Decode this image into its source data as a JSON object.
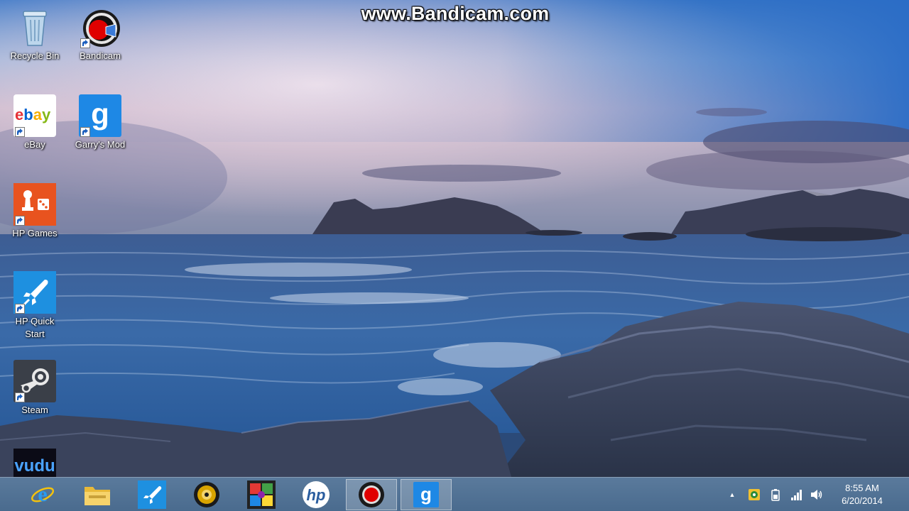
{
  "watermark": "www.Bandicam.com",
  "desktop": {
    "icons": [
      {
        "label": "Recycle Bin",
        "icon": "recycle-bin-icon"
      },
      {
        "label": "Bandicam",
        "icon": "bandicam-icon"
      },
      {
        "label": "eBay",
        "icon": "ebay-icon"
      },
      {
        "label": "Garry's Mod",
        "icon": "garrys-mod-icon"
      },
      {
        "label": "HP Games",
        "icon": "hp-games-icon"
      },
      {
        "label": "HP Quick Start",
        "icon": "hp-quick-start-icon"
      },
      {
        "label": "Steam",
        "icon": "steam-icon"
      },
      {
        "label": "vudu",
        "icon": "vudu-icon"
      }
    ]
  },
  "taskbar": {
    "pinned": [
      {
        "name": "internet-explorer",
        "icon": "internet-explorer-icon"
      },
      {
        "name": "file-explorer",
        "icon": "file-explorer-icon"
      },
      {
        "name": "hp-quick-start",
        "icon": "rocket-icon"
      },
      {
        "name": "media-player",
        "icon": "media-player-icon"
      },
      {
        "name": "games",
        "icon": "puzzle-icon"
      },
      {
        "name": "hp-support",
        "icon": "hp-logo-icon"
      },
      {
        "name": "bandicam",
        "icon": "bandicam-record-icon",
        "active": true
      },
      {
        "name": "garrys-mod",
        "icon": "garrys-mod-icon",
        "active": true
      }
    ],
    "tray": {
      "show_hidden": "▲",
      "icons": [
        "hp-support-icon",
        "power-icon",
        "network-signal-icon",
        "volume-icon"
      ],
      "time": "8:55 AM",
      "date": "6/20/2014"
    }
  },
  "colors": {
    "taskbar": "#4f7194",
    "ebay_red": "#e53238",
    "ebay_blue": "#0064d2",
    "ebay_yellow": "#f5af02",
    "ebay_green": "#86b817",
    "gmod_blue": "#1e88e5",
    "hp_games_orange": "#e8531f",
    "hp_quick_blue": "#1e90e0"
  }
}
